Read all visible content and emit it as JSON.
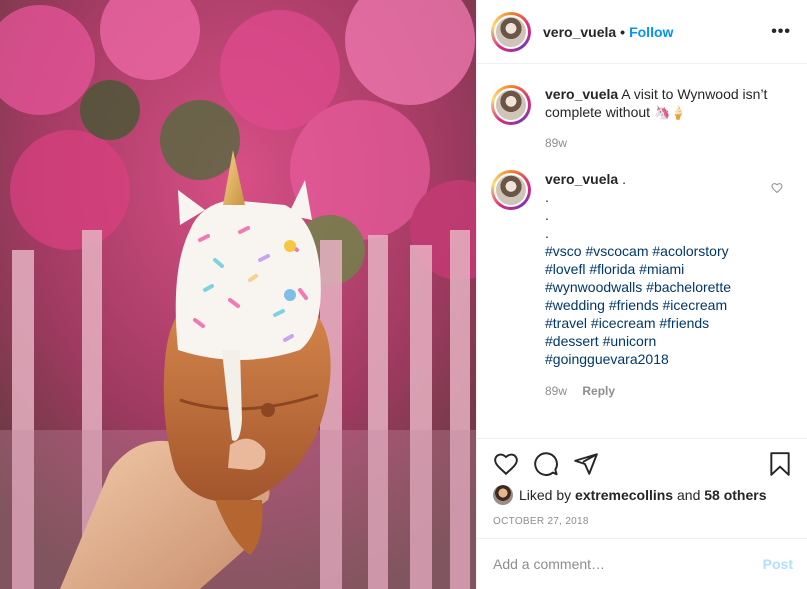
{
  "header": {
    "username": "vero_vuela",
    "separator": "•",
    "follow_label": "Follow",
    "more_label": "•••"
  },
  "caption": {
    "username": "vero_vuela",
    "text": "A visit to Wynwood isn’t complete without",
    "emoji": "🦄🍦",
    "time": "89w"
  },
  "comment": {
    "username": "vero_vuela",
    "first_line": ".",
    "dots": [
      ".",
      ".",
      "."
    ],
    "hashtags": [
      "#vsco #vscocam #acolorstory",
      "#lovefl #florida #miami",
      "#wynwoodwalls #bachelorette",
      "#wedding #friends #icecream",
      "#travel #icecream #friends",
      "#dessert #unicorn",
      "#goingguevara2018"
    ],
    "time": "89w",
    "reply_label": "Reply"
  },
  "likes": {
    "prefix": "Liked by",
    "user": "extremecollins",
    "and": "and",
    "others": "58 others"
  },
  "date": "OCTOBER 27, 2018",
  "add_comment": {
    "placeholder": "Add a comment…",
    "post_label": "Post"
  },
  "colors": {
    "link_blue": "#0095f6",
    "hashtag": "#00376b",
    "muted": "#8e8e8e",
    "post_disabled": "#b2dffc"
  },
  "icons": [
    "more-icon",
    "heart-icon",
    "comment-icon",
    "share-icon",
    "bookmark-icon"
  ]
}
